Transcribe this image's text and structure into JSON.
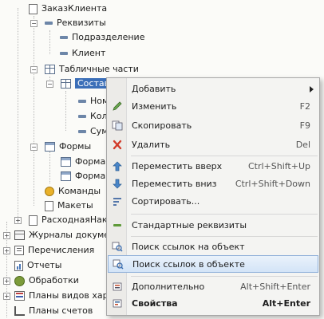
{
  "tree": {
    "top_node": "ЗаказКлиента",
    "attributes_group": "Реквизиты",
    "attr_1": "Подразделение",
    "attr_2": "Клиент",
    "tabular_group": "Табличные части",
    "tabular_selected": "Состав",
    "sub_1": "Ном",
    "sub_2": "Кол",
    "sub_3": "Сум",
    "forms_group": "Формы",
    "form_1": "Форма",
    "form_2": "Форма",
    "commands": "Команды",
    "layouts": "Макеты",
    "doc_2": "РасходнаяНак",
    "journals": "Журналы докумен",
    "enums": "Перечисления",
    "reports": "Отчеты",
    "processors": "Обработки",
    "chart_types": "Планы видов хара",
    "chart_accounts": "Планы счетов"
  },
  "menu": {
    "add": "Добавить",
    "edit": "Изменить",
    "edit_sc": "F2",
    "copy": "Скопировать",
    "copy_sc": "F9",
    "delete": "Удалить",
    "delete_sc": "Del",
    "move_up": "Переместить вверх",
    "move_up_sc": "Ctrl+Shift+Up",
    "move_down": "Переместить вниз",
    "move_down_sc": "Ctrl+Shift+Down",
    "sort": "Сортировать...",
    "std_attrs": "Стандартные реквизиты",
    "find_refs_to": "Поиск ссылок на объект",
    "find_refs_in": "Поиск ссылок в объекте",
    "advanced": "Дополнительно",
    "advanced_sc": "Alt+Shift+Enter",
    "properties": "Свойства",
    "properties_sc": "Alt+Enter"
  },
  "colors": {
    "selection": "#3b6fb8",
    "highlight_border": "#8fb0d9"
  }
}
